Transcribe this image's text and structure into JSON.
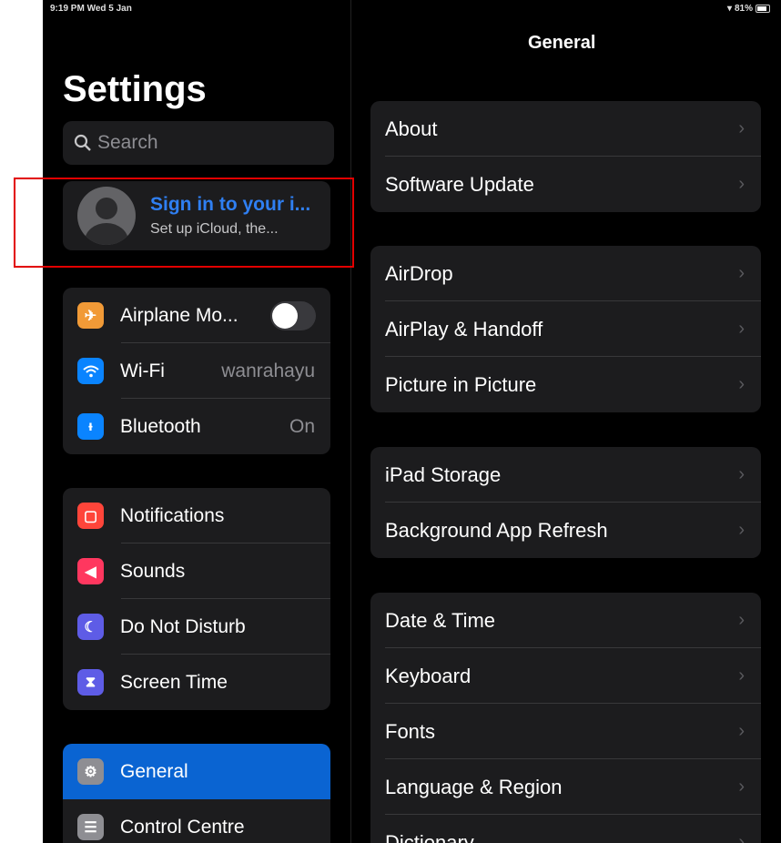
{
  "status": {
    "time": "9:19 PM  Wed 5 Jan",
    "battery": "81%"
  },
  "sidebar": {
    "title": "Settings",
    "search_placeholder": "Search",
    "profile": {
      "title": "Sign in to your i...",
      "subtitle": "Set up iCloud, the..."
    },
    "group1": [
      {
        "label": "Airplane Mo...",
        "icon": "airplane-icon",
        "color": "#f19a37"
      },
      {
        "label": "Wi-Fi",
        "value": "wanrahayu",
        "icon": "wifi-icon",
        "color": "#0a84ff"
      },
      {
        "label": "Bluetooth",
        "value": "On",
        "icon": "bluetooth-icon",
        "color": "#0a84ff"
      }
    ],
    "group2": [
      {
        "label": "Notifications",
        "icon": "notifications-icon",
        "color": "#ff453a"
      },
      {
        "label": "Sounds",
        "icon": "sounds-icon",
        "color": "#ff375f"
      },
      {
        "label": "Do Not Disturb",
        "icon": "moon-icon",
        "color": "#5e5ce6"
      },
      {
        "label": "Screen Time",
        "icon": "hourglass-icon",
        "color": "#5e5ce6"
      }
    ],
    "group3": [
      {
        "label": "General",
        "icon": "gear-icon",
        "color": "#8e8e93"
      },
      {
        "label": "Control Centre",
        "icon": "control-centre-icon",
        "color": "#8e8e93"
      }
    ]
  },
  "detail": {
    "title": "General",
    "groups": [
      [
        "About",
        "Software Update"
      ],
      [
        "AirDrop",
        "AirPlay & Handoff",
        "Picture in Picture"
      ],
      [
        "iPad Storage",
        "Background App Refresh"
      ],
      [
        "Date & Time",
        "Keyboard",
        "Fonts",
        "Language & Region",
        "Dictionary"
      ]
    ]
  },
  "colors": {
    "accent": "#0a64d2",
    "link": "#2f7ff2",
    "highlight": "#e20000"
  }
}
